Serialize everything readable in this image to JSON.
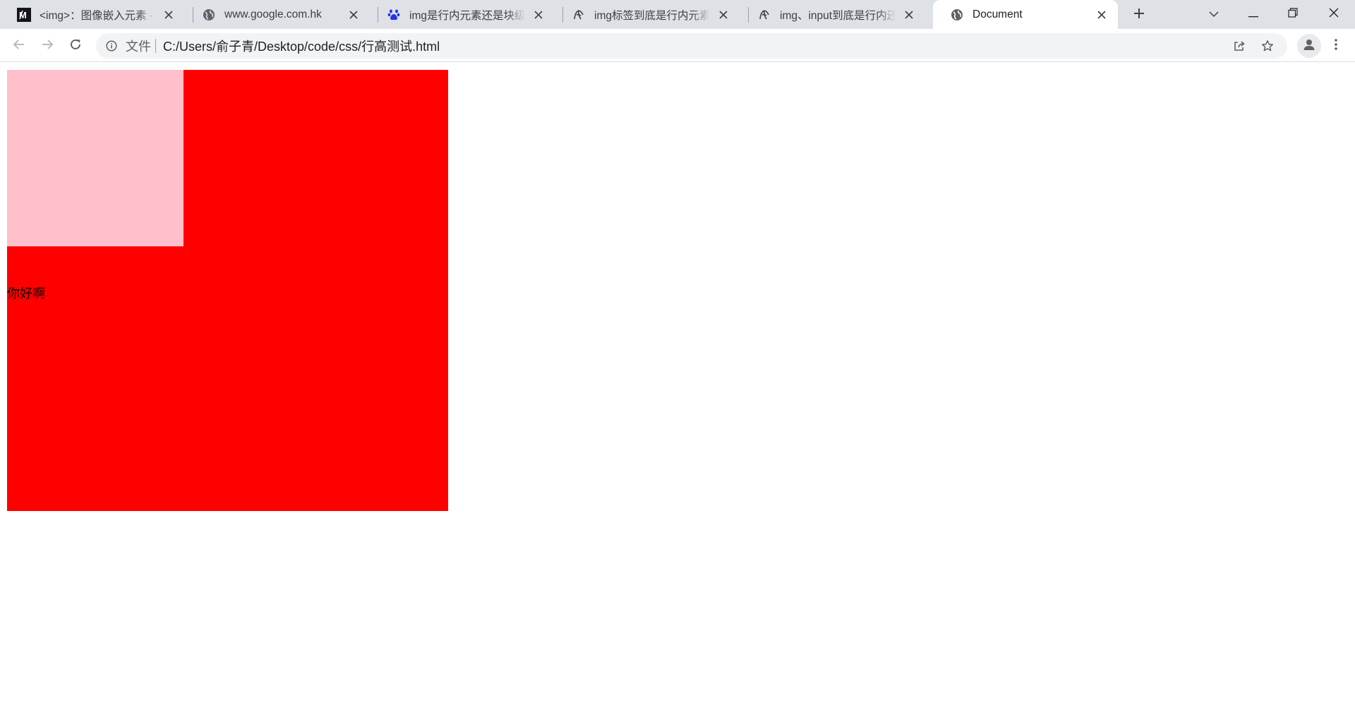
{
  "tabs": [
    {
      "title": "<img>：图像嵌入元素 - HTML",
      "favicon": "mdn-icon"
    },
    {
      "title": "www.google.com.hk",
      "favicon": "globe-icon"
    },
    {
      "title": "img是行内元素还是块级元素",
      "favicon": "baidu-paw-icon"
    },
    {
      "title": "img标签到底是行内元素还是块级元素",
      "favicon": "spider-icon"
    },
    {
      "title": "img、input到底是行内还是块级元素",
      "favicon": "spider-icon"
    },
    {
      "title": "Document",
      "favicon": "globe-icon",
      "active": true
    }
  ],
  "omnibox": {
    "security_label": "文件",
    "url": "C:/Users/俞子青/Desktop/code/css/行高测试.html"
  },
  "page": {
    "text": "你好啊",
    "outer_box_color": "#ff0000",
    "inner_box_color": "#ffc0cb"
  }
}
